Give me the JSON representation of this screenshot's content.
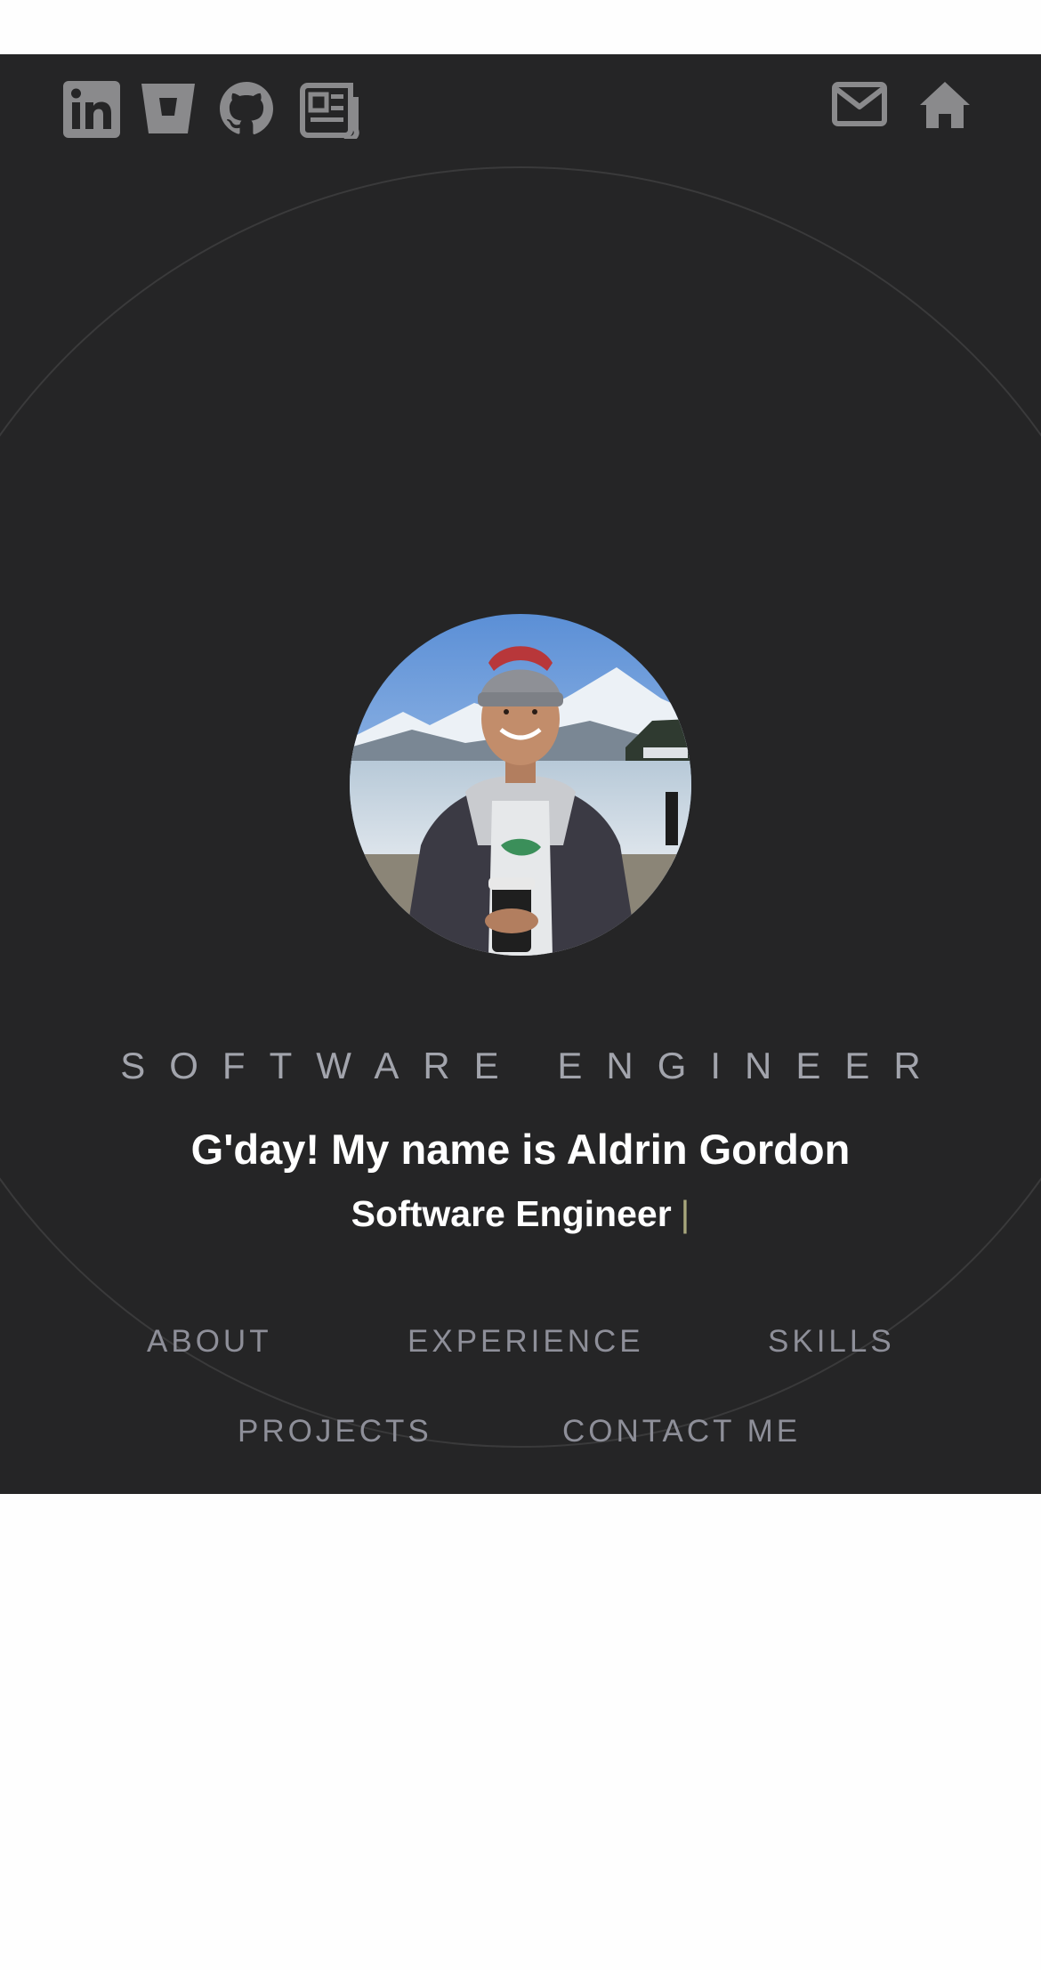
{
  "header": {
    "social_icons": [
      "linkedin-icon",
      "bitbucket-icon",
      "github-icon",
      "blog-icon"
    ],
    "right_icons": [
      "mail-icon",
      "home-icon"
    ],
    "icon_color": "#8a8a8c"
  },
  "hero": {
    "background_color": "#252526",
    "role_label": "SOFTWARE ENGINEER",
    "greeting": "G'day! My name is Aldrin Gordon",
    "typed_title": "Software Engineer",
    "cursor_char": "|",
    "cursor_color": "#a8a77d"
  },
  "nav": {
    "items": [
      "ABOUT",
      "EXPERIENCE",
      "SKILLS",
      "PROJECTS",
      "CONTACT ME"
    ]
  }
}
